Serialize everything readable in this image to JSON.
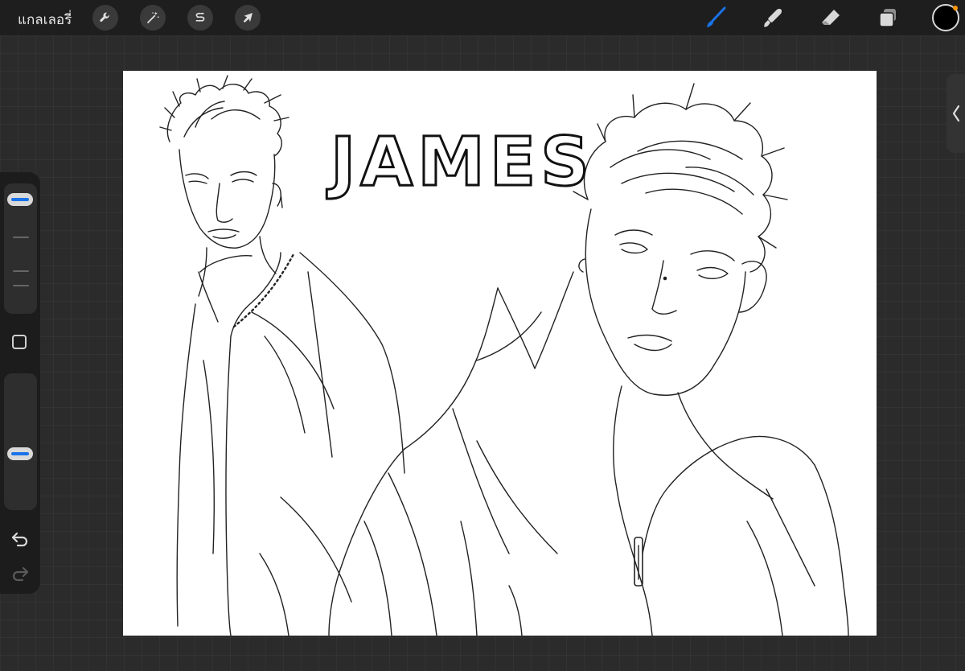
{
  "app": {
    "gallery_label": "แกลเลอรี่"
  },
  "top_toolbar": {
    "left_tools": [
      {
        "name": "actions",
        "icon": "wrench-icon"
      },
      {
        "name": "adjustments",
        "icon": "magic-wand-icon"
      },
      {
        "name": "selection",
        "icon": "selection-s-icon"
      },
      {
        "name": "transform",
        "icon": "arrow-cursor-icon"
      }
    ],
    "right_tools": [
      {
        "name": "brush",
        "icon": "brush-icon",
        "active": true
      },
      {
        "name": "smudge",
        "icon": "smudge-icon"
      },
      {
        "name": "eraser",
        "icon": "eraser-icon"
      },
      {
        "name": "layers",
        "icon": "layers-icon"
      }
    ],
    "current_color": "#000000",
    "accent_color": "#1a73e8"
  },
  "canvas": {
    "title_text": "JAMES",
    "background": "#ffffff"
  },
  "sidebar": {
    "brush_size_level": 0.94,
    "opacity_level": 0.4,
    "undo_icon": "undo-icon",
    "redo_icon": "redo-icon"
  }
}
